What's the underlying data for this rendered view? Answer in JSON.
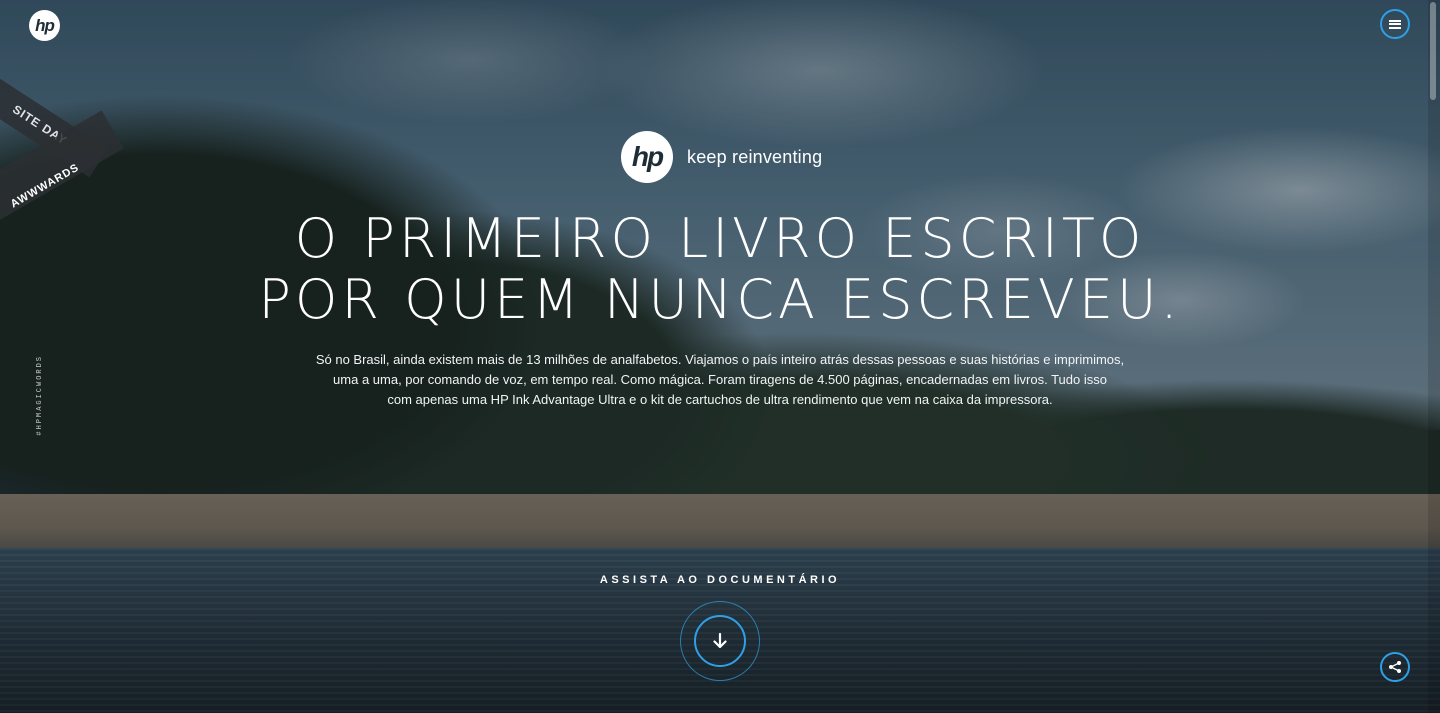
{
  "header": {
    "logo_text": "hp",
    "menu_label": "Menu"
  },
  "badge": {
    "site_of_the_day": "SITE DAY",
    "awwwards": "AWWWARDS",
    "hashtag": "#HPMAGICWORDS"
  },
  "hero": {
    "brand_logo": "hp",
    "tagline": "keep reinventing",
    "headline_line1": "O PRIMEIRO LIVRO ESCRITO",
    "headline_line2": "POR QUEM NUNCA ESCREVEU.",
    "body_line1": "Só no Brasil, ainda existem mais de 13 milhões de analfabetos. Viajamos o país inteiro atrás dessas pessoas e suas histórias e imprimimos,",
    "body_line2": "uma a uma, por comando de voz, em tempo real. Como mágica. Foram tiragens de 4.500 páginas, encadernadas em livros. Tudo isso",
    "body_line3": "com apenas uma HP Ink Advantage Ultra e o kit de cartuchos de ultra rendimento que vem na caixa da impressora."
  },
  "cta": {
    "label": "ASSISTA AO DOCUMENTÁRIO"
  },
  "icons": {
    "menu": "hamburger-icon",
    "scroll": "arrow-down-icon",
    "share": "share-icon"
  },
  "colors": {
    "accent": "#2f9fe6"
  }
}
